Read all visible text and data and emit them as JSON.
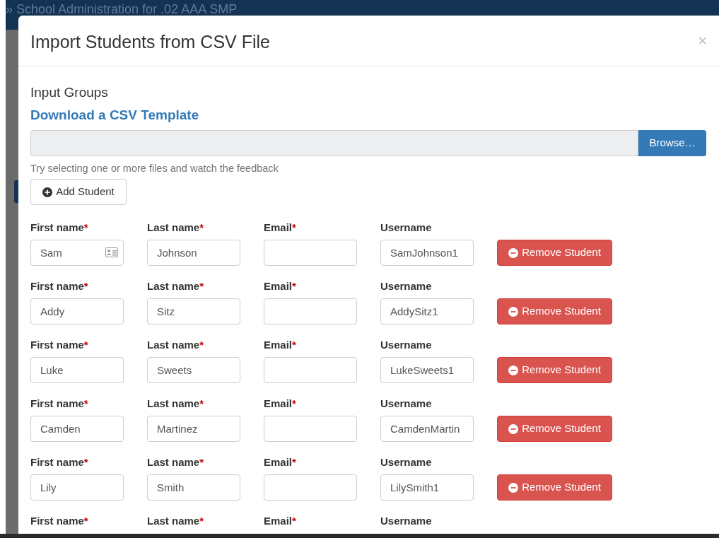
{
  "background": {
    "header_text": "» School Administration for .02 AAA SMP"
  },
  "modal": {
    "title": "Import Students from CSV File",
    "close": "×",
    "section_title": "Input Groups",
    "template_link": "Download a CSV Template",
    "file_input": {
      "button": "Browse…",
      "help": "Try selecting one or more files and watch the feedback"
    },
    "add_button": "Add Student",
    "rows": [
      {
        "cut_off": false,
        "remove_button": "Remove Student",
        "fields": [
          {
            "label": "First name",
            "required_mark": "*",
            "value": "Sam",
            "contact_icon": true
          },
          {
            "label": "Last name",
            "required_mark": "*",
            "value": "Johnson"
          },
          {
            "label": "Email",
            "required_mark": "*"
          },
          {
            "label": "Username",
            "value": "SamJohnson1"
          }
        ]
      },
      {
        "cut_off": false,
        "remove_button": "Remove Student",
        "fields": [
          {
            "label": "First name",
            "required_mark": "*",
            "value": "Addy"
          },
          {
            "label": "Last name",
            "required_mark": "*",
            "value": "Sitz"
          },
          {
            "label": "Email",
            "required_mark": "*"
          },
          {
            "label": "Username",
            "value": "AddySitz1"
          }
        ]
      },
      {
        "cut_off": false,
        "remove_button": "Remove Student",
        "fields": [
          {
            "label": "First name",
            "required_mark": "*",
            "value": "Luke"
          },
          {
            "label": "Last name",
            "required_mark": "*",
            "value": "Sweets"
          },
          {
            "label": "Email",
            "required_mark": "*"
          },
          {
            "label": "Username",
            "value": "LukeSweets1"
          }
        ]
      },
      {
        "cut_off": false,
        "remove_button": "Remove Student",
        "fields": [
          {
            "label": "First name",
            "required_mark": "*",
            "value": "Camden"
          },
          {
            "label": "Last name",
            "required_mark": "*",
            "value": "Martinez"
          },
          {
            "label": "Email",
            "required_mark": "*"
          },
          {
            "label": "Username",
            "value": "CamdenMartin"
          }
        ]
      },
      {
        "cut_off": false,
        "remove_button": "Remove Student",
        "fields": [
          {
            "label": "First name",
            "required_mark": "*",
            "value": "Lily"
          },
          {
            "label": "Last name",
            "required_mark": "*",
            "value": "Smith"
          },
          {
            "label": "Email",
            "required_mark": "*"
          },
          {
            "label": "Username",
            "value": "LilySmith1"
          }
        ]
      },
      {
        "cut_off": true,
        "fields": [
          {
            "label": "First name",
            "required_mark": "*"
          },
          {
            "label": "Last name",
            "required_mark": "*"
          },
          {
            "label": "Email",
            "required_mark": "*"
          },
          {
            "label": "Username"
          }
        ]
      }
    ]
  }
}
